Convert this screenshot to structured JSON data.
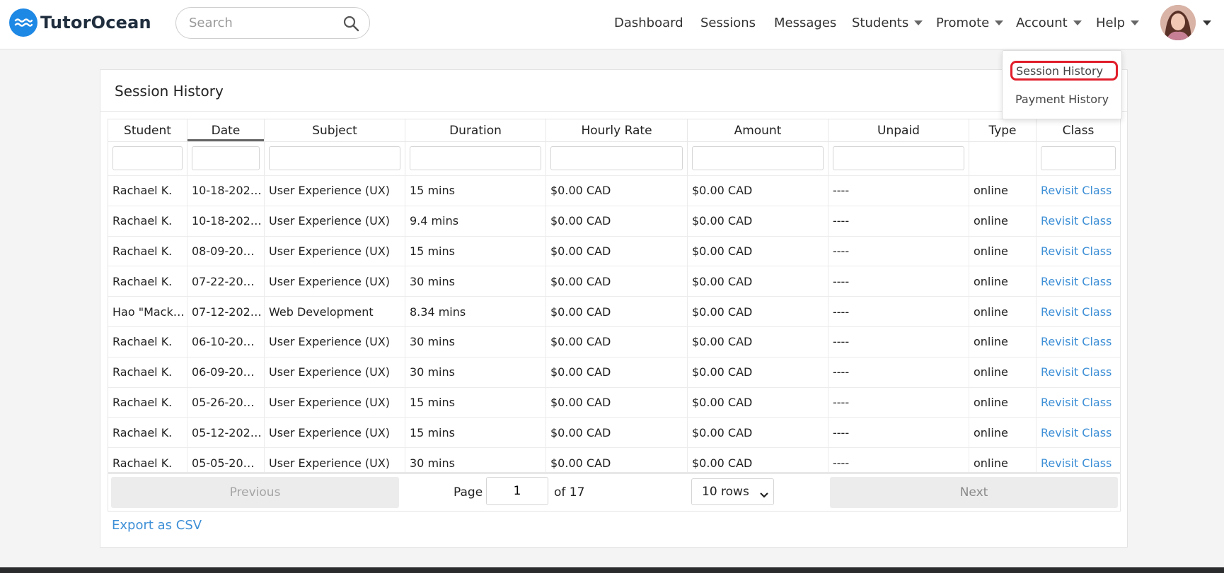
{
  "brand": {
    "name": "TutorOcean",
    "color": "#1e88e5"
  },
  "search": {
    "placeholder": "Search"
  },
  "nav": {
    "dashboard": "Dashboard",
    "sessions": "Sessions",
    "messages": "Messages",
    "students": "Students",
    "promote": "Promote",
    "account": "Account",
    "help": "Help"
  },
  "account_menu": {
    "items": [
      {
        "label": "Session History",
        "highlighted": true
      },
      {
        "label": "Payment History",
        "highlighted": false
      }
    ],
    "highlight_color": "#e11d2a"
  },
  "page": {
    "title": "Session History"
  },
  "table": {
    "columns": [
      "Student",
      "Date",
      "Subject",
      "Duration",
      "Hourly Rate",
      "Amount",
      "Unpaid",
      "Type",
      "Class"
    ],
    "sorted_column": "Date",
    "rows": [
      [
        "Rachael K.",
        "10-18-202…",
        "User Experience (UX)",
        "15 mins",
        "$0.00 CAD",
        "$0.00 CAD",
        "----",
        "online",
        "Revisit Class"
      ],
      [
        "Rachael K.",
        "10-18-202…",
        "User Experience (UX)",
        "9.4 mins",
        "$0.00 CAD",
        "$0.00 CAD",
        "----",
        "online",
        "Revisit Class"
      ],
      [
        "Rachael K.",
        "08-09-20…",
        "User Experience (UX)",
        "15 mins",
        "$0.00 CAD",
        "$0.00 CAD",
        "----",
        "online",
        "Revisit Class"
      ],
      [
        "Rachael K.",
        "07-22-20…",
        "User Experience (UX)",
        "30 mins",
        "$0.00 CAD",
        "$0.00 CAD",
        "----",
        "online",
        "Revisit Class"
      ],
      [
        "Hao \"Mack…",
        "07-12-202…",
        "Web Development",
        "8.34 mins",
        "$0.00 CAD",
        "$0.00 CAD",
        "----",
        "online",
        "Revisit Class"
      ],
      [
        "Rachael K.",
        "06-10-20…",
        "User Experience (UX)",
        "30 mins",
        "$0.00 CAD",
        "$0.00 CAD",
        "----",
        "online",
        "Revisit Class"
      ],
      [
        "Rachael K.",
        "06-09-20…",
        "User Experience (UX)",
        "30 mins",
        "$0.00 CAD",
        "$0.00 CAD",
        "----",
        "online",
        "Revisit Class"
      ],
      [
        "Rachael K.",
        "05-26-20…",
        "User Experience (UX)",
        "15 mins",
        "$0.00 CAD",
        "$0.00 CAD",
        "----",
        "online",
        "Revisit Class"
      ],
      [
        "Rachael K.",
        "05-12-202…",
        "User Experience (UX)",
        "15 mins",
        "$0.00 CAD",
        "$0.00 CAD",
        "----",
        "online",
        "Revisit Class"
      ],
      [
        "Rachael K.",
        "05-05-20…",
        "User Experience (UX)",
        "30 mins",
        "$0.00 CAD",
        "$0.00 CAD",
        "----",
        "online",
        "Revisit Class"
      ]
    ]
  },
  "pagination": {
    "previous_label": "Previous",
    "next_label": "Next",
    "page_label": "Page",
    "current_page": "1",
    "of_label": "of 17",
    "rows_option": "10 rows"
  },
  "export_label": "Export as CSV",
  "link_color": "#3d8fd6"
}
